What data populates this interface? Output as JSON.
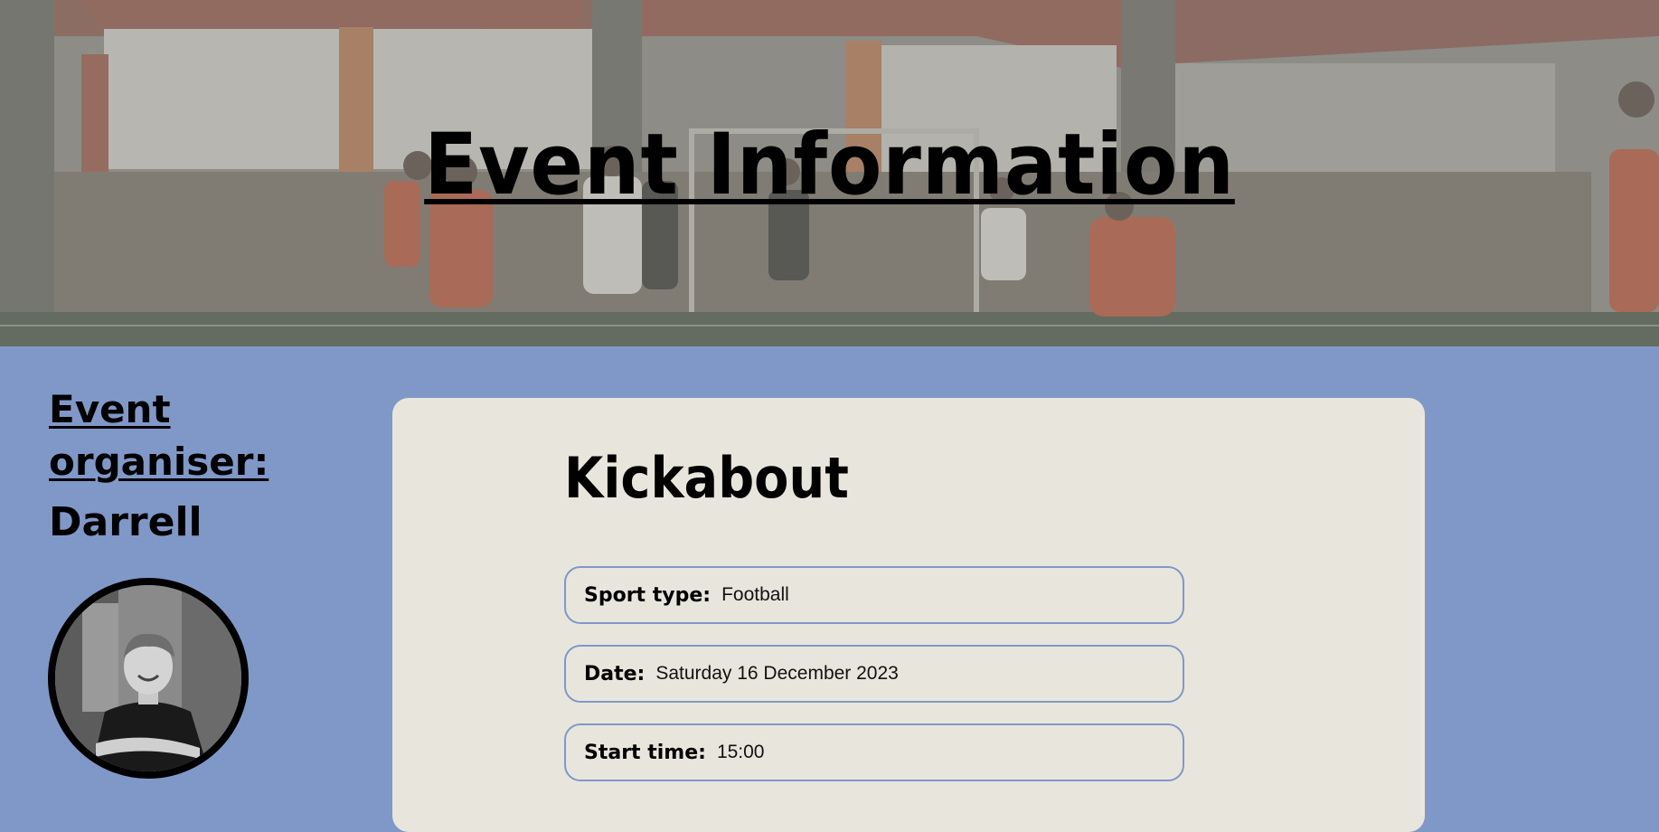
{
  "hero": {
    "title": "Event Information"
  },
  "organiser": {
    "heading": "Event organiser:",
    "name": "Darrell"
  },
  "event": {
    "name": "Kickabout",
    "fields": [
      {
        "label": "Sport type:",
        "value": "Football"
      },
      {
        "label": "Date:",
        "value": "Saturday 16 December 2023"
      },
      {
        "label": "Start time:",
        "value": "15:00"
      }
    ]
  },
  "colors": {
    "page_background": "#8098c8",
    "card_background": "#e8e6dc",
    "field_border": "#7f98c8"
  }
}
